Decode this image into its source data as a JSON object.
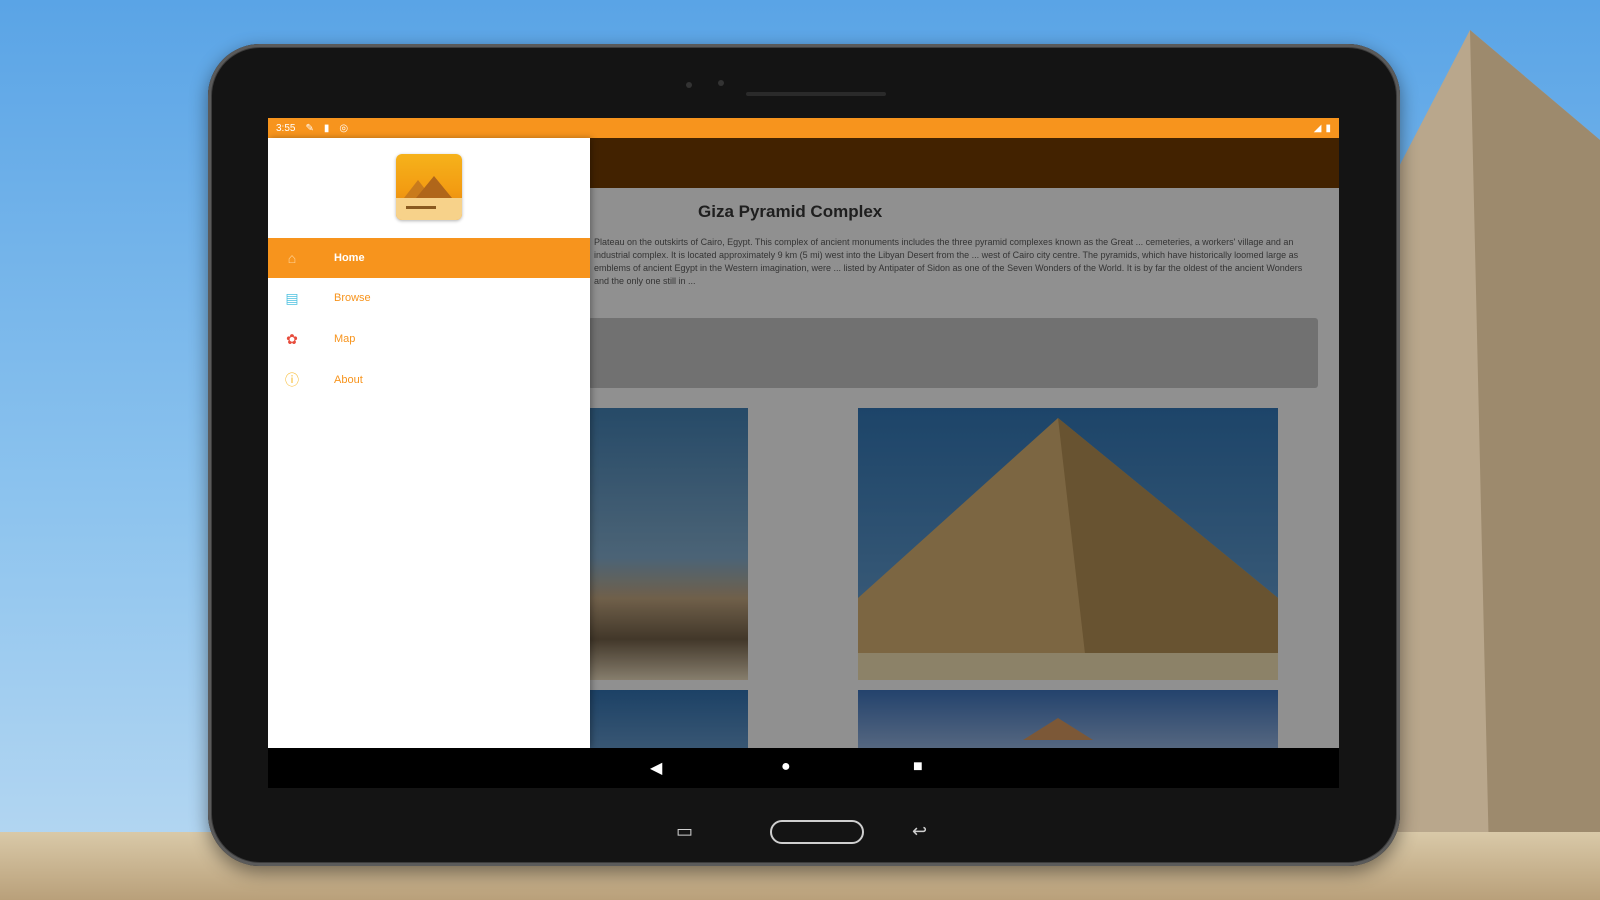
{
  "status_bar": {
    "time": "3:55",
    "icons": [
      "edit-icon",
      "sd-card-icon",
      "sync-icon"
    ],
    "right_icons": [
      "signal-icon",
      "battery-icon"
    ]
  },
  "content": {
    "title": "Giza Pyramid Complex",
    "paragraph": "Plateau on the outskirts of Cairo, Egypt. This complex of ancient monuments includes the three pyramid complexes known as the Great ... cemeteries, a workers' village and an industrial complex. It is located approximately 9 km (5 mi) west into the Libyan Desert from the ... west of Cairo city centre. The pyramids, which have historically loomed large as emblems of ancient Egypt in the Western imagination, were ... listed by Antipater of Sidon as one of the Seven Wonders of the World. It is by far the oldest of the ancient Wonders and the only one still in ..."
  },
  "drawer": {
    "logo_icon": "pyramid-logo-icon",
    "items": [
      {
        "label": "Home",
        "icon": "home-icon",
        "active": true
      },
      {
        "label": "Browse",
        "icon": "book-icon",
        "active": false
      },
      {
        "label": "Map",
        "icon": "map-pin-icon",
        "active": false
      },
      {
        "label": "About",
        "icon": "info-icon",
        "active": false
      }
    ]
  },
  "nav_bar": {
    "back": "◀",
    "home": "●",
    "recents": "■"
  },
  "tablet_buttons": {
    "recent": "▭",
    "back": "↩"
  },
  "colors": {
    "accent": "#f7941d",
    "toolbar": "#6b3800",
    "drawer_bg": "#ffffff"
  }
}
